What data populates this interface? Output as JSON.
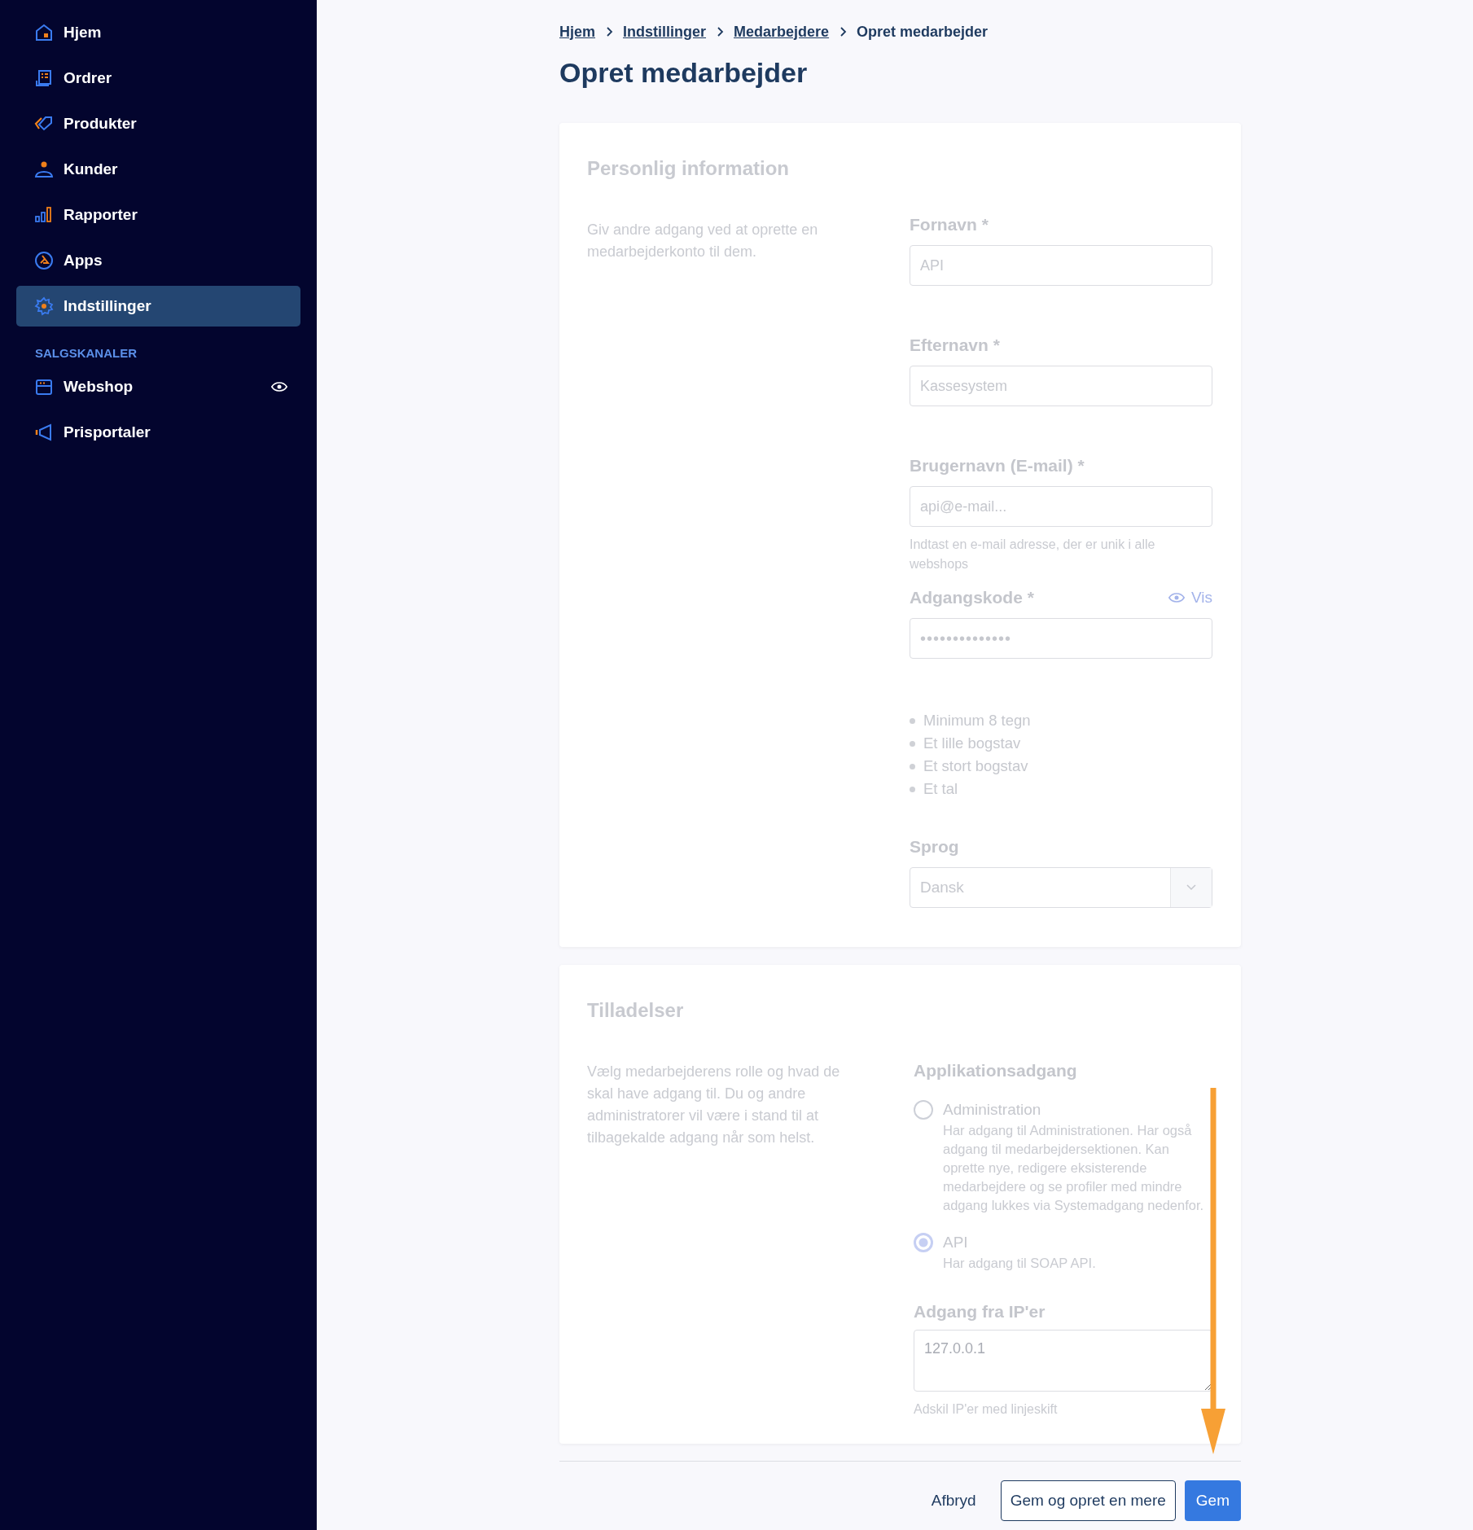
{
  "sidebar": {
    "items": [
      {
        "label": "Hjem",
        "selected": false
      },
      {
        "label": "Ordrer",
        "selected": false
      },
      {
        "label": "Produkter",
        "selected": false
      },
      {
        "label": "Kunder",
        "selected": false
      },
      {
        "label": "Rapporter",
        "selected": false
      },
      {
        "label": "Apps",
        "selected": false
      },
      {
        "label": "Indstillinger",
        "selected": true
      }
    ],
    "section_title": "SALGSKANALER",
    "channels": [
      {
        "label": "Webshop",
        "selected": false,
        "preview": true
      },
      {
        "label": "Prisportaler",
        "selected": false,
        "preview": false
      }
    ]
  },
  "breadcrumb": [
    {
      "label": "Hjem",
      "link": true
    },
    {
      "label": "Indstillinger",
      "link": true
    },
    {
      "label": "Medarbejdere",
      "link": true
    },
    {
      "label": "Opret medarbejder",
      "link": false
    }
  ],
  "title": "Opret medarbejder",
  "personal": {
    "title": "Personlig information",
    "description": "Giv andre adgang ved at oprette en medarbejderkonto til dem.",
    "fields": [
      {
        "kind": "text",
        "label": "Fornavn *",
        "value": "API"
      },
      {
        "kind": "text",
        "label": "Efternavn *",
        "value": "Kassesystem"
      },
      {
        "kind": "text",
        "label": "Brugernavn (E-mail) *",
        "value": "api@e-mail...",
        "hint": "Indtast en e-mail adresse, der er unik i alle webshops"
      },
      {
        "kind": "password",
        "label": "Adgangskode *",
        "value": "••••••••••••••",
        "toggle": "Vis",
        "requirements": [
          "Minimum 8 tegn",
          "Et lille bogstav",
          "Et stort bogstav",
          "Et tal"
        ]
      },
      {
        "kind": "select",
        "label": "Sprog",
        "value": "Dansk"
      }
    ]
  },
  "permissions": {
    "title": "Tilladelser",
    "description": "Vælg medarbejderens rolle og hvad de skal have adgang til. Du og andre administratorer vil være i stand til at tilbagekalde adgang når som helst.",
    "access_title": "Applikationsadgang",
    "options": [
      {
        "label": "Administration",
        "description": "Har adgang til Administrationen. Har også adgang til medarbejdersektionen. Kan oprette nye, redigere eksisterende medarbejdere og se profiler med mindre adgang lukkes via Systemadgang nedenfor.",
        "selected": false
      },
      {
        "label": "API",
        "description": "Har adgang til SOAP API.",
        "selected": true
      }
    ],
    "ip_label": "Adgang fra IP'er",
    "ip_placeholder": "127.0.0.1",
    "ip_hint": "Adskil IP'er med linjeskift"
  },
  "actions": [
    {
      "kind": "link",
      "label": "Afbryd"
    },
    {
      "kind": "secondary",
      "label": "Gem og opret en mere"
    },
    {
      "kind": "primary",
      "label": "Gem"
    }
  ]
}
